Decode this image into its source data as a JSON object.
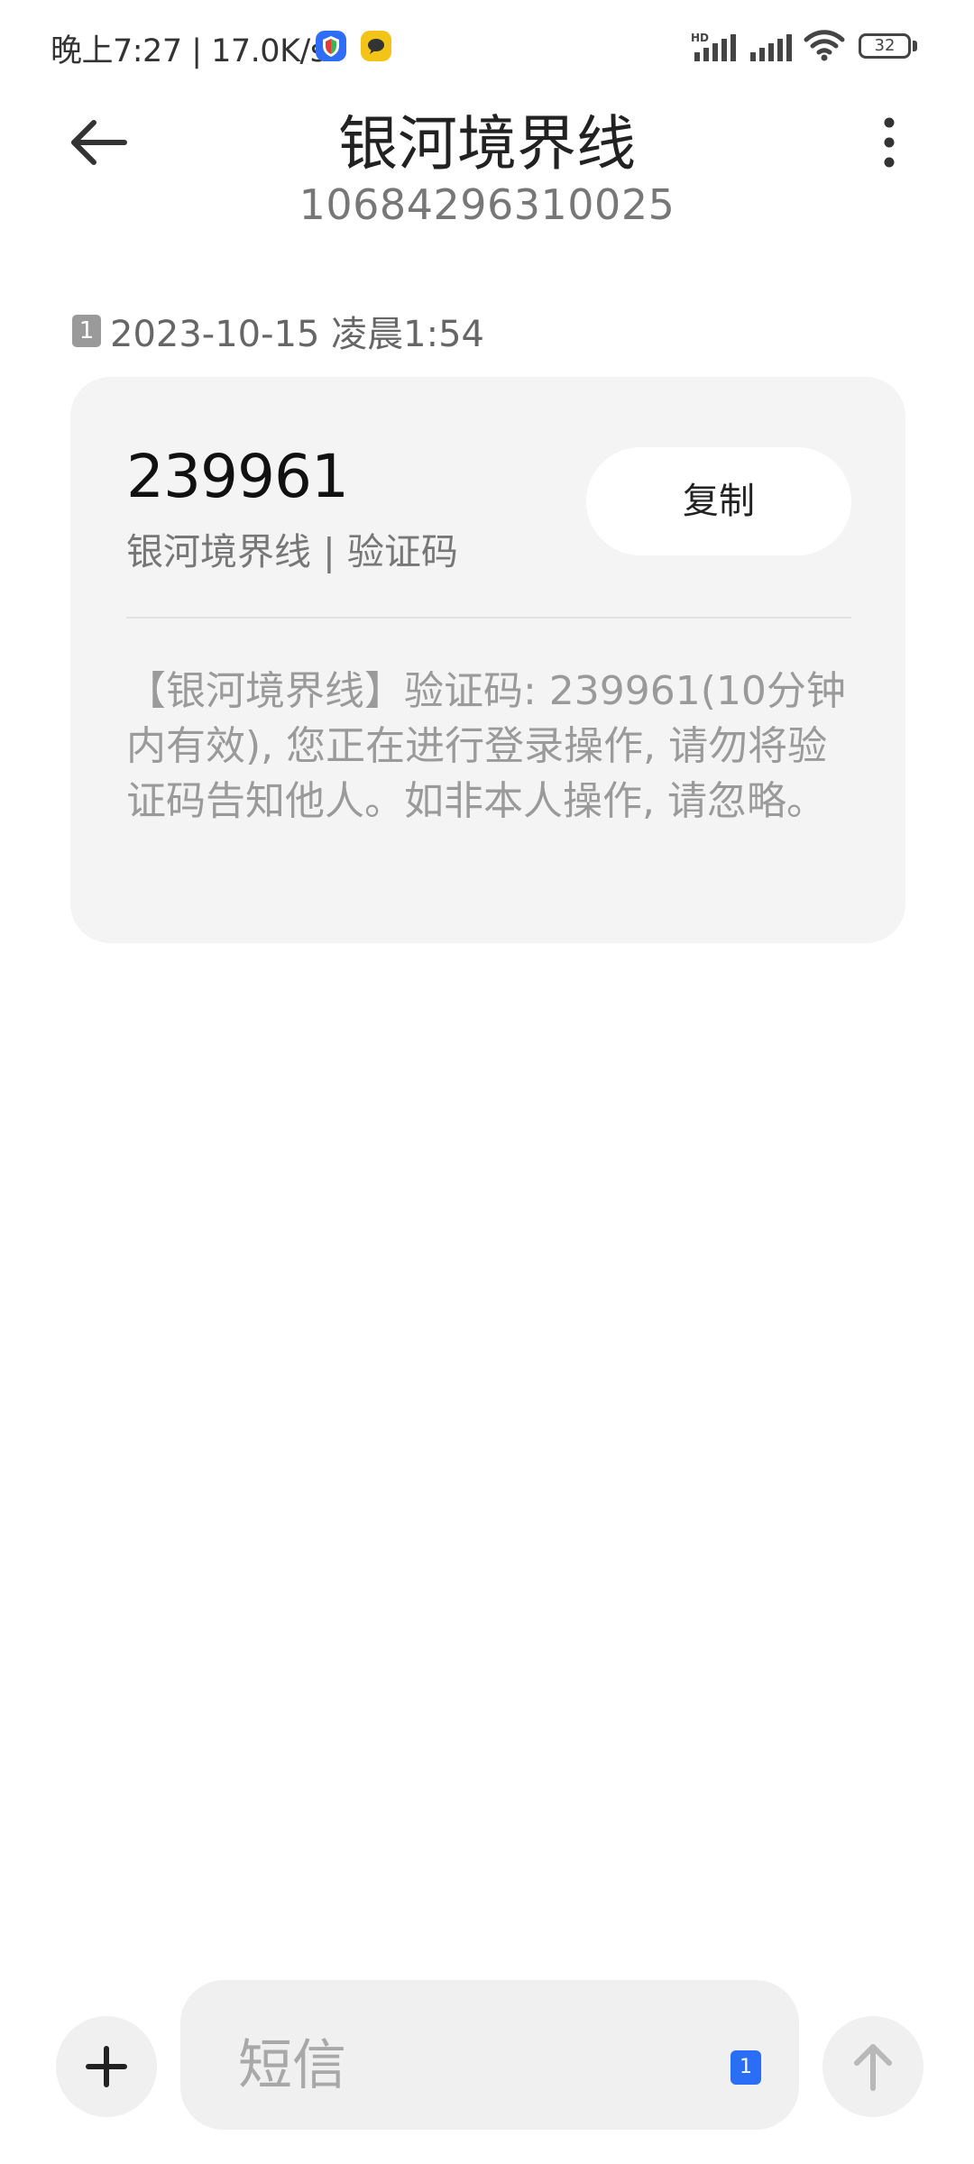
{
  "status_bar": {
    "time_speed": "晚上7:27 | 17.0K/s",
    "battery_level": "32",
    "battery_fraction": 0.32,
    "hd_label": "HD",
    "icons": [
      "shield-app-icon",
      "chat-app-icon",
      "hd-signal-icon",
      "signal-icon",
      "wifi-icon",
      "battery-icon"
    ]
  },
  "header": {
    "title": "银河境界线",
    "phone_number": "10684296310025"
  },
  "message": {
    "sim_slot": "1",
    "timestamp": "2023-10-15 凌晨1:54",
    "code": "239961",
    "code_source": "银河境界线 | 验证码",
    "copy_label": "复制",
    "body": "【银河境界线】验证码: 239961(10分钟内有效), 您正在进行登录操作, 请勿将验证码告知他人。如非本人操作, 请忽略。"
  },
  "compose": {
    "placeholder": "短信",
    "sim_slot": "1"
  },
  "colors": {
    "card_bg": "#f4f4f4",
    "sim_chip": "#2a6ef5",
    "muted_text": "#9a9a9a"
  }
}
